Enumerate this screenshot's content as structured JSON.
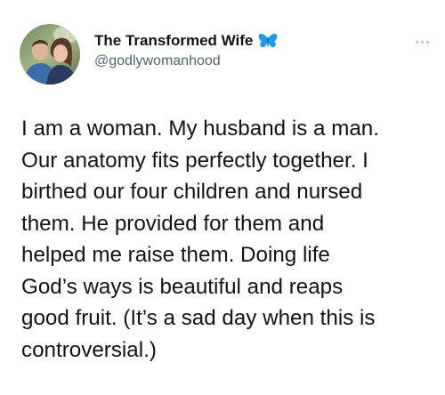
{
  "author": {
    "display_name": "The Transformed Wife",
    "handle": "@godlywomanhood",
    "avatar": "profile-photo-couple",
    "badge_icon": "butterfly-icon",
    "badge_color": "#1d9bf0"
  },
  "menu": {
    "icon": "more-options-icon"
  },
  "tweet": {
    "lines": [
      "I am a woman. My husband is a man.",
      "Our anatomy fits perfectly together. I",
      "birthed our four children and nursed",
      "them. He provided for them and",
      "helped me raise them. Doing life",
      "God’s ways is beautiful and reaps",
      "good fruit. (It’s a sad day when this is",
      "controversial.)"
    ]
  },
  "colors": {
    "text_primary": "#0f1419",
    "text_secondary": "#536471",
    "accent": "#1d9bf0"
  }
}
